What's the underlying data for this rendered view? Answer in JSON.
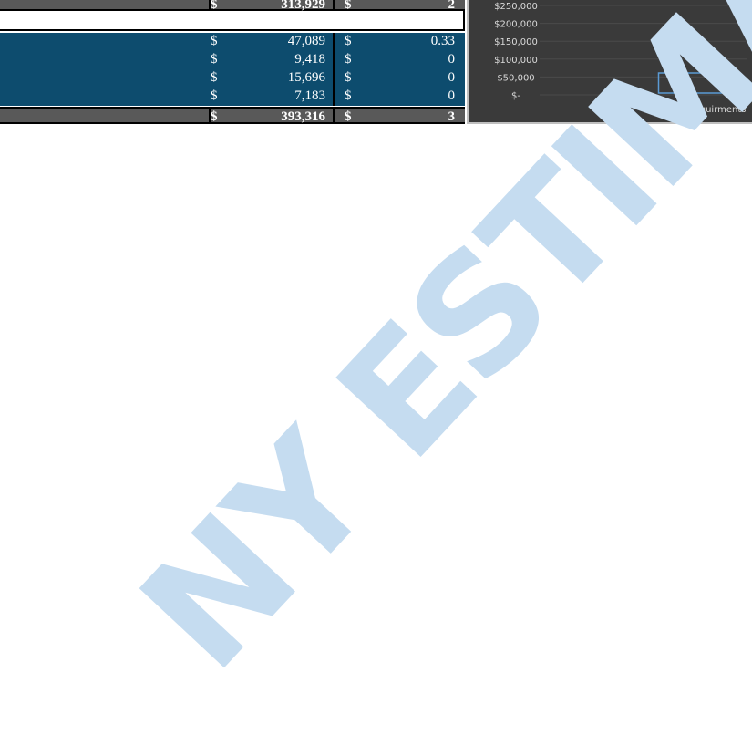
{
  "sheet": {
    "top_row": {
      "dollar1": "$",
      "value1": "313,929",
      "dollar2": "$",
      "value2": "2"
    },
    "rows": [
      {
        "dollar1": "$",
        "value1": "47,089",
        "dollar2": "$",
        "value2": "0.33"
      },
      {
        "dollar1": "$",
        "value1": "9,418",
        "dollar2": "$",
        "value2": "0"
      },
      {
        "dollar1": "$",
        "value1": "15,696",
        "dollar2": "$",
        "value2": "0"
      },
      {
        "dollar1": "$",
        "value1": "7,183",
        "dollar2": "$",
        "value2": "0"
      }
    ],
    "total_row": {
      "dollar1": "$",
      "value1": "393,316",
      "dollar2": "$",
      "value2": "3"
    }
  },
  "chart_data": {
    "type": "bar",
    "categories": [
      "General Requirments"
    ],
    "values": [
      0
    ],
    "ylim": [
      0,
      250000
    ],
    "ytick_values": [
      0,
      50000,
      100000,
      150000,
      200000,
      250000
    ],
    "ytick_labels": [
      "$-",
      "$50,000",
      "$100,000",
      "$150,000",
      "$200,000",
      "$250,000"
    ],
    "grid": true,
    "colors": {
      "background": "#3a3a3a",
      "text": "#d9d9d9",
      "gridline": "#4a4a4a",
      "bar_outline": "#5b9bd5"
    }
  },
  "watermark": {
    "text": "NY ESTIMATING",
    "color": "#c5dcf0"
  }
}
